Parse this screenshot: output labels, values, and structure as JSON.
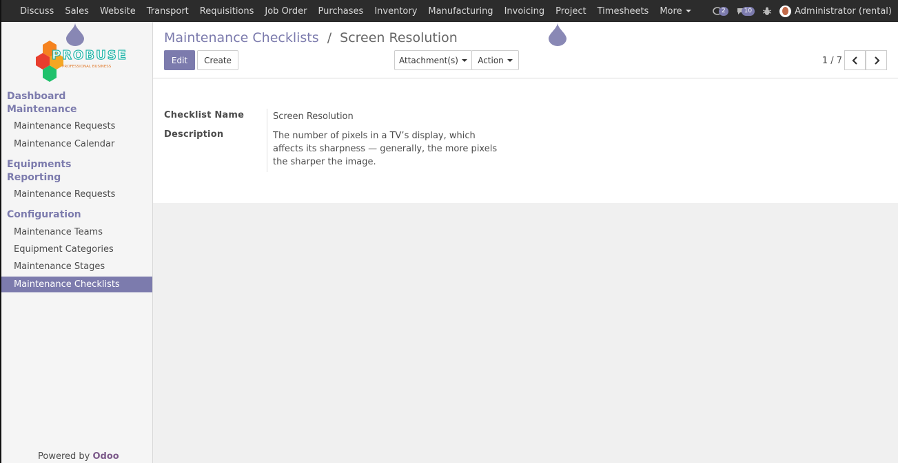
{
  "topnav": {
    "menu": [
      "Discuss",
      "Sales",
      "Website",
      "Transport",
      "Requisitions",
      "Job Order",
      "Purchases",
      "Inventory",
      "Manufacturing",
      "Invoicing",
      "Project",
      "Timesheets"
    ],
    "more_label": "More",
    "conversation_badge": "2",
    "messages_badge": "10",
    "user": "Administrator (rental)"
  },
  "logo": {
    "name": "PROBUSE",
    "tagline": "PROFESSIONAL BUSINESS"
  },
  "sidebar": {
    "sections": {
      "dashboard": "Dashboard",
      "maintenance": "Maintenance",
      "equipments": "Equipments",
      "reporting": "Reporting",
      "configuration": "Configuration"
    },
    "items": {
      "maint_requests": "Maintenance Requests",
      "maint_calendar": "Maintenance Calendar",
      "report_requests": "Maintenance Requests",
      "teams": "Maintenance Teams",
      "categories": "Equipment Categories",
      "stages": "Maintenance Stages",
      "checklists": "Maintenance Checklists"
    },
    "powered_prefix": "Powered by",
    "powered_brand": "Odoo"
  },
  "control_panel": {
    "breadcrumb_parent": "Maintenance Checklists",
    "breadcrumb_sep": "/",
    "breadcrumb_current": "Screen Resolution",
    "edit_label": "Edit",
    "create_label": "Create",
    "attachments_label": "Attachment(s)",
    "action_label": "Action",
    "pager": "1 / 7"
  },
  "form": {
    "name_label": "Checklist Name",
    "name_value": "Screen Resolution",
    "description_label": "Description",
    "description_value": "The number of pixels in a TV’s display, which affects its sharpness — generally, the more pixels the sharper the image."
  },
  "colors": {
    "accent": "#7c7bad",
    "topbar": "#2c2c2c"
  }
}
